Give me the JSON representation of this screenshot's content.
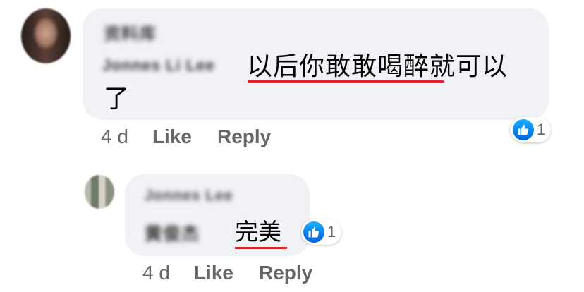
{
  "comments": [
    {
      "author": "资料库",
      "mention": "Jonnes Li Lee",
      "text_line1": "以后你敢敢喝醉就可以",
      "text_line2": "了",
      "reaction_count": "1",
      "time": "4 d",
      "like_label": "Like",
      "reply_label": "Reply",
      "reply": {
        "author": "Jonnes Lee",
        "mention": "黄俊杰",
        "text": "完美",
        "reaction_count": "1",
        "time": "4 d",
        "like_label": "Like",
        "reply_label": "Reply"
      }
    }
  ],
  "colors": {
    "bubble": "#f0f2f5",
    "underline": "#e0242b",
    "like_blue": "#1877f2",
    "meta_text": "#65676b"
  },
  "icons": {
    "reaction": "thumbs-up-icon"
  }
}
